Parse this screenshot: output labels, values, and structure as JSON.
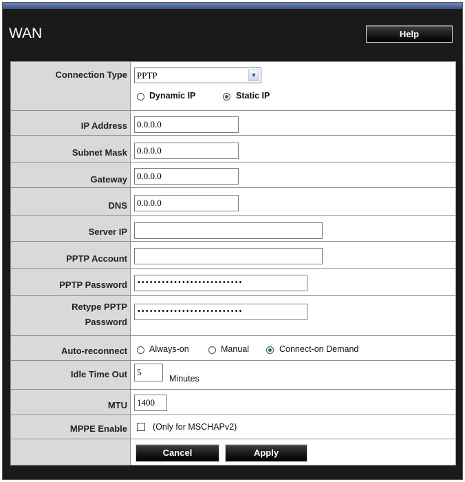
{
  "page": {
    "title": "WAN",
    "help_label": "Help"
  },
  "form": {
    "connection_type": {
      "label": "Connection Type",
      "selected": "PPTP",
      "options": [
        "PPTP"
      ],
      "mode_options": [
        {
          "label": "Dynamic IP",
          "checked": false
        },
        {
          "label": "Static IP",
          "checked": true
        }
      ]
    },
    "ip_address": {
      "label": "IP Address",
      "value": "0.0.0.0"
    },
    "subnet_mask": {
      "label": "Subnet Mask",
      "value": "0.0.0.0"
    },
    "gateway": {
      "label": "Gateway",
      "value": "0.0.0.0"
    },
    "dns": {
      "label": "DNS",
      "value": "0.0.0.0"
    },
    "server_ip": {
      "label": "Server IP",
      "value": ""
    },
    "pptp_account": {
      "label": "PPTP Account",
      "value": ""
    },
    "pptp_password": {
      "label": "PPTP Password",
      "value": "••••••••••••••••••••••••••"
    },
    "retype_password": {
      "label_line1": "Retype PPTP",
      "label_line2": "Password",
      "value": "••••••••••••••••••••••••••"
    },
    "auto_reconnect": {
      "label": "Auto-reconnect",
      "options": [
        {
          "label": "Always-on",
          "checked": false
        },
        {
          "label": "Manual",
          "checked": false
        },
        {
          "label": "Connect-on Demand",
          "checked": true
        }
      ]
    },
    "idle_timeout": {
      "label": "Idle Time Out",
      "value": "5",
      "unit": "Minutes"
    },
    "mtu": {
      "label": "MTU",
      "value": "1400"
    },
    "mppe": {
      "label": "MPPE Enable",
      "checked": false,
      "note": "(Only for MSCHAPv2)"
    }
  },
  "actions": {
    "cancel_label": "Cancel",
    "apply_label": "Apply"
  }
}
